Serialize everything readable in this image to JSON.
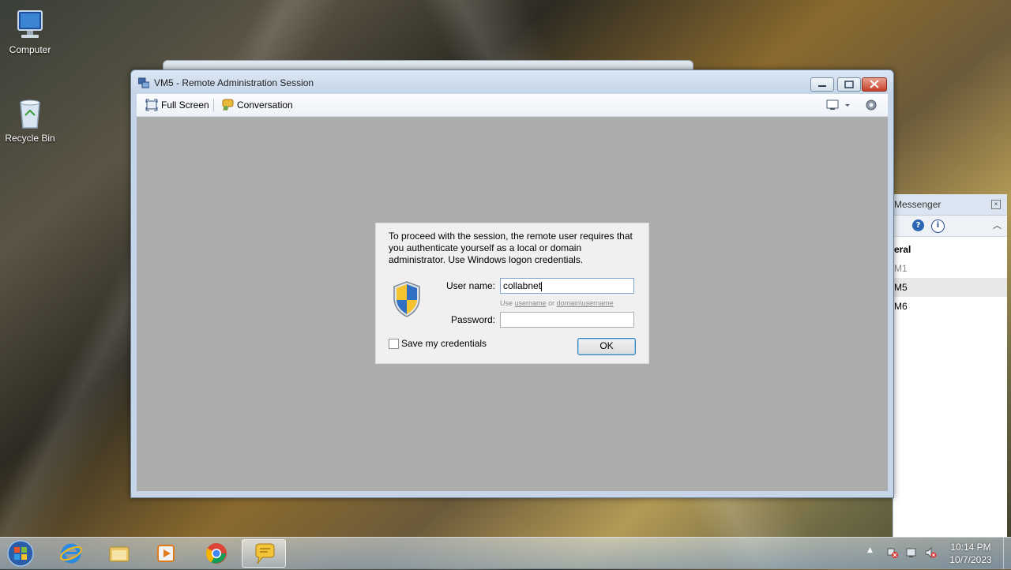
{
  "desktop": {
    "icons": [
      {
        "label": "Computer"
      },
      {
        "label": "Recycle Bin"
      }
    ]
  },
  "window": {
    "title": "VM5 - Remote Administration Session",
    "toolbar": {
      "full_screen": "Full Screen",
      "conversation": "Conversation"
    }
  },
  "dialog": {
    "message": "To proceed with the session, the remote user requires that you authenticate yourself as a local or domain administrator. Use Windows logon credentials.",
    "username_label": "User name:",
    "username_value": "collabnet",
    "hint_prefix": "Use",
    "hint_username": "username",
    "hint_or": "or",
    "hint_domain": "domain\\username",
    "password_label": "Password:",
    "password_value": "",
    "save_credentials": "Save my credentials",
    "ok": "OK"
  },
  "messenger": {
    "title": "Messenger",
    "group": "eral",
    "items": [
      "M1",
      "M5",
      "M6"
    ]
  },
  "taskbar": {
    "time": "10:14 PM",
    "date": "10/7/2023"
  },
  "colors": {
    "close_button": "#c7422a",
    "ok_focus": "#3c7fb1",
    "content_bg": "#acacac"
  }
}
